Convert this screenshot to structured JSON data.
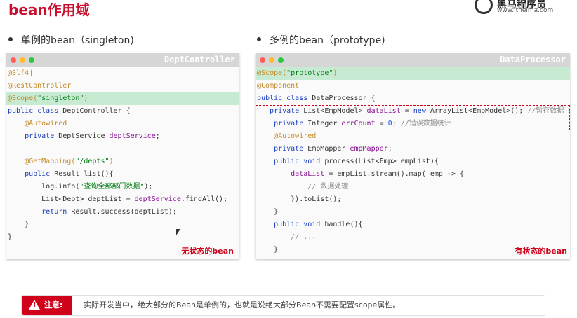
{
  "page": {
    "title": "bean作用域",
    "logo": {
      "name": "黑马程序员",
      "url": "www.itheima.com"
    }
  },
  "left": {
    "section_title": "单例的bean（singleton)",
    "file_name": "DeptController",
    "label": "无状态的bean",
    "lines": [
      {
        "hl": false,
        "tokens": [
          {
            "t": "@Slf4j",
            "c": "an"
          }
        ]
      },
      {
        "hl": false,
        "tokens": [
          {
            "t": "@RestController",
            "c": "an"
          }
        ]
      },
      {
        "hl": true,
        "tokens": [
          {
            "t": "@Scope(",
            "c": "an"
          },
          {
            "t": "\"singleton\"",
            "c": "st"
          },
          {
            "t": ")",
            "c": "an"
          }
        ]
      },
      {
        "hl": false,
        "tokens": [
          {
            "t": "public class ",
            "c": "kw"
          },
          {
            "t": "DeptController {",
            "c": ""
          }
        ]
      },
      {
        "hl": false,
        "tokens": [
          {
            "t": "    @Autowired",
            "c": "an"
          }
        ]
      },
      {
        "hl": false,
        "tokens": [
          {
            "t": "    private ",
            "c": "kw"
          },
          {
            "t": "DeptService ",
            "c": ""
          },
          {
            "t": "deptService",
            "c": "fd"
          },
          {
            "t": ";",
            "c": ""
          }
        ]
      },
      {
        "hl": false,
        "tokens": [
          {
            "t": "",
            "c": ""
          }
        ]
      },
      {
        "hl": false,
        "tokens": [
          {
            "t": "    @GetMapping(",
            "c": "an"
          },
          {
            "t": "\"/depts\"",
            "c": "st"
          },
          {
            "t": ")",
            "c": "an"
          }
        ]
      },
      {
        "hl": false,
        "tokens": [
          {
            "t": "    public ",
            "c": "kw"
          },
          {
            "t": "Result list(){",
            "c": ""
          }
        ]
      },
      {
        "hl": false,
        "tokens": [
          {
            "t": "        log.info(",
            "c": ""
          },
          {
            "t": "\"查询全部部门数据\"",
            "c": "st"
          },
          {
            "t": ");",
            "c": ""
          }
        ]
      },
      {
        "hl": false,
        "tokens": [
          {
            "t": "        List<Dept> deptList = ",
            "c": ""
          },
          {
            "t": "deptService",
            "c": "fd"
          },
          {
            "t": ".findAll();",
            "c": ""
          }
        ]
      },
      {
        "hl": false,
        "tokens": [
          {
            "t": "        return ",
            "c": "kw"
          },
          {
            "t": "Result.success(deptList);",
            "c": ""
          }
        ]
      },
      {
        "hl": false,
        "tokens": [
          {
            "t": "    }",
            "c": ""
          }
        ]
      },
      {
        "hl": false,
        "tokens": [
          {
            "t": "}",
            "c": ""
          }
        ]
      }
    ]
  },
  "right": {
    "section_title": "多例的bean（prototype)",
    "file_name": "DataProcessor",
    "label": "有状态的bean",
    "lines": [
      {
        "hl": true,
        "tokens": [
          {
            "t": "@Scope(",
            "c": "an"
          },
          {
            "t": "\"prototype\"",
            "c": "st"
          },
          {
            "t": ")",
            "c": "an"
          }
        ]
      },
      {
        "hl": false,
        "tokens": [
          {
            "t": "@Component",
            "c": "an"
          }
        ]
      },
      {
        "hl": false,
        "tokens": [
          {
            "t": "public class ",
            "c": "kw"
          },
          {
            "t": "DataProcessor {",
            "c": ""
          }
        ]
      },
      {
        "hl": false,
        "tokens": [
          {
            "t": "   private ",
            "c": "kw"
          },
          {
            "t": "List<EmpModel> ",
            "c": ""
          },
          {
            "t": "dataList",
            "c": "fd"
          },
          {
            "t": " = ",
            "c": ""
          },
          {
            "t": "new ",
            "c": "kw"
          },
          {
            "t": "ArrayList<EmpModel>(); ",
            "c": ""
          },
          {
            "t": "//暂存数据",
            "c": "cm"
          }
        ]
      },
      {
        "hl": false,
        "tokens": [
          {
            "t": "    private ",
            "c": "kw"
          },
          {
            "t": "Integer ",
            "c": ""
          },
          {
            "t": "errCount",
            "c": "fd"
          },
          {
            "t": " = ",
            "c": ""
          },
          {
            "t": "0",
            "c": "nm"
          },
          {
            "t": "; ",
            "c": ""
          },
          {
            "t": "//错误数据统计",
            "c": "cm"
          }
        ]
      },
      {
        "hl": false,
        "tokens": [
          {
            "t": "    @Autowired",
            "c": "an"
          }
        ]
      },
      {
        "hl": false,
        "tokens": [
          {
            "t": "    private ",
            "c": "kw"
          },
          {
            "t": "EmpMapper ",
            "c": ""
          },
          {
            "t": "empMapper",
            "c": "fd"
          },
          {
            "t": ";",
            "c": ""
          }
        ]
      },
      {
        "hl": false,
        "tokens": [
          {
            "t": "    public void ",
            "c": "kw"
          },
          {
            "t": "process(List<Emp> empList){",
            "c": ""
          }
        ]
      },
      {
        "hl": false,
        "tokens": [
          {
            "t": "        dataList",
            "c": "fd"
          },
          {
            "t": " = empList.stream().map( emp -> {",
            "c": ""
          }
        ]
      },
      {
        "hl": false,
        "tokens": [
          {
            "t": "            // 数据处理",
            "c": "cm"
          }
        ]
      },
      {
        "hl": false,
        "tokens": [
          {
            "t": "        }).toList();",
            "c": ""
          }
        ]
      },
      {
        "hl": false,
        "tokens": [
          {
            "t": "    }",
            "c": ""
          }
        ]
      },
      {
        "hl": false,
        "tokens": [
          {
            "t": "    public void ",
            "c": "kw"
          },
          {
            "t": "handle(){",
            "c": ""
          }
        ]
      },
      {
        "hl": false,
        "tokens": [
          {
            "t": "        // ...",
            "c": "cm"
          }
        ]
      },
      {
        "hl": false,
        "tokens": [
          {
            "t": "    }",
            "c": ""
          }
        ]
      }
    ]
  },
  "note": {
    "tag": "注意:",
    "icon": "warning-icon",
    "text": "实际开发当中，绝大部分的Bean是单例的，也就是说绝大部分Bean不需要配置scope属性。"
  },
  "colors": {
    "title_red": "#c8102e",
    "highlight_green": "#c6ead2",
    "window_red": "#ff5f57",
    "window_yellow": "#febc2e",
    "window_green": "#28c840"
  }
}
